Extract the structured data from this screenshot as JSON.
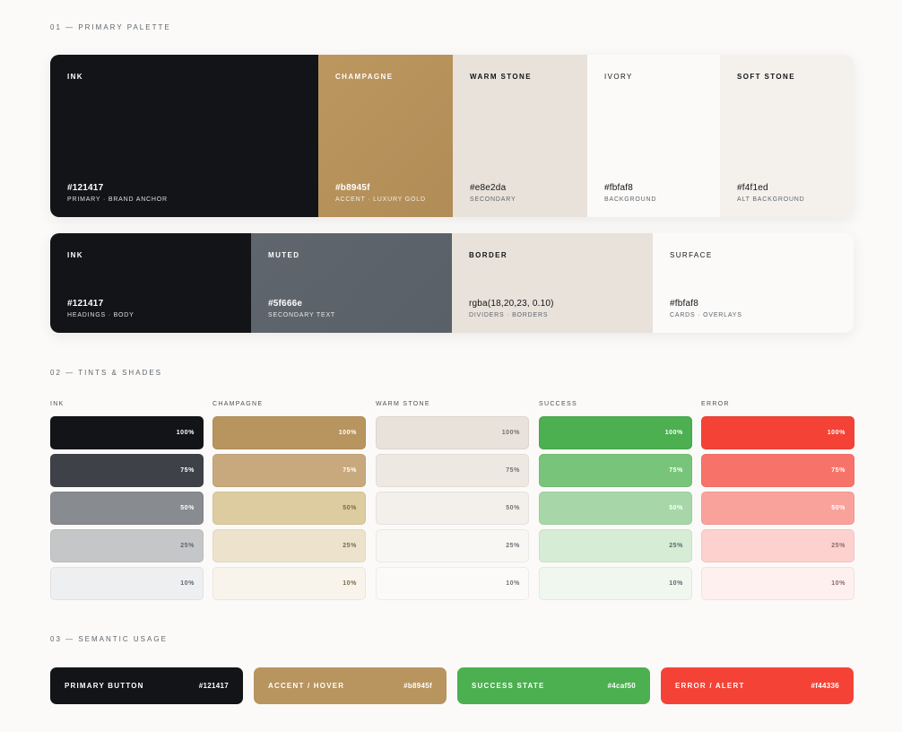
{
  "sections": {
    "primary": "01 — PRIMARY PALETTE",
    "tints": "02 — TINTS & SHADES",
    "semantic": "03 — SEMANTIC USAGE"
  },
  "primary_palette": [
    {
      "name": "INK",
      "hex": "#121417",
      "desc": "PRIMARY · BRAND ANCHOR",
      "color": "#121417"
    },
    {
      "name": "CHAMPAGNE",
      "hex": "#b8945f",
      "desc": "ACCENT · LUXURY GOLD",
      "color": "#b8945f"
    },
    {
      "name": "WARM STONE",
      "hex": "#e8e2da",
      "desc": "SECONDARY",
      "color": "#e8e2da"
    },
    {
      "name": "IVORY",
      "hex": "#fbfaf8",
      "desc": "BACKGROUND",
      "color": "#fbfaf8"
    },
    {
      "name": "SOFT STONE",
      "hex": "#f4f1ed",
      "desc": "ALT BACKGROUND",
      "color": "#f4f1ed"
    }
  ],
  "ui_palette": [
    {
      "name": "INK",
      "hex": "#121417",
      "desc": "HEADINGS · BODY",
      "color": "#121417"
    },
    {
      "name": "MUTED",
      "hex": "#5f666e",
      "desc": "SECONDARY TEXT",
      "color": "#5f666e"
    },
    {
      "name": "BORDER",
      "hex": "rgba(18,20,23, 0.10)",
      "desc": "DIVIDERS · BORDERS",
      "color": "#e8e2da"
    },
    {
      "name": "SURFACE",
      "hex": "#fbfaf8",
      "desc": "CARDS · OVERLAYS",
      "color": "#fbfaf8"
    }
  ],
  "tints": [
    {
      "label": "INK",
      "steps": [
        {
          "pct": "100%",
          "color": "#121417"
        },
        {
          "pct": "75%",
          "color": "#3e4147"
        },
        {
          "pct": "50%",
          "color": "#888b90"
        },
        {
          "pct": "25%",
          "color": "#c5c6c8"
        },
        {
          "pct": "10%",
          "color": "#eeeff0"
        }
      ]
    },
    {
      "label": "CHAMPAGNE",
      "steps": [
        {
          "pct": "100%",
          "color": "#b8945f"
        },
        {
          "pct": "75%",
          "color": "#c8a97e"
        },
        {
          "pct": "50%",
          "color": "#dccca0"
        },
        {
          "pct": "25%",
          "color": "#ede3cc"
        },
        {
          "pct": "10%",
          "color": "#f8f4ec"
        }
      ]
    },
    {
      "label": "WARM STONE",
      "steps": [
        {
          "pct": "100%",
          "color": "#e8e2da"
        },
        {
          "pct": "75%",
          "color": "#ede9e2"
        },
        {
          "pct": "50%",
          "color": "#f3f0ec"
        },
        {
          "pct": "25%",
          "color": "#f8f7f4"
        },
        {
          "pct": "10%",
          "color": "#fbfaf9"
        }
      ]
    },
    {
      "label": "SUCCESS",
      "steps": [
        {
          "pct": "100%",
          "color": "#4caf50"
        },
        {
          "pct": "75%",
          "color": "#79c47b"
        },
        {
          "pct": "50%",
          "color": "#a7d7a8"
        },
        {
          "pct": "25%",
          "color": "#d6ecd5"
        },
        {
          "pct": "10%",
          "color": "#eff7ee"
        }
      ]
    },
    {
      "label": "ERROR",
      "steps": [
        {
          "pct": "100%",
          "color": "#f44336"
        },
        {
          "pct": "75%",
          "color": "#f7736a"
        },
        {
          "pct": "50%",
          "color": "#f9a29c"
        },
        {
          "pct": "25%",
          "color": "#fdd1ce"
        },
        {
          "pct": "10%",
          "color": "#fdf0ee"
        }
      ]
    }
  ],
  "semantic": [
    {
      "label": "PRIMARY BUTTON",
      "hex": "#121417",
      "color": "#121417"
    },
    {
      "label": "ACCENT / HOVER",
      "hex": "#b8945f",
      "color": "#b8945f"
    },
    {
      "label": "SUCCESS STATE",
      "hex": "#4caf50",
      "color": "#4caf50"
    },
    {
      "label": "ERROR / ALERT",
      "hex": "#f44336",
      "color": "#f44336"
    }
  ]
}
